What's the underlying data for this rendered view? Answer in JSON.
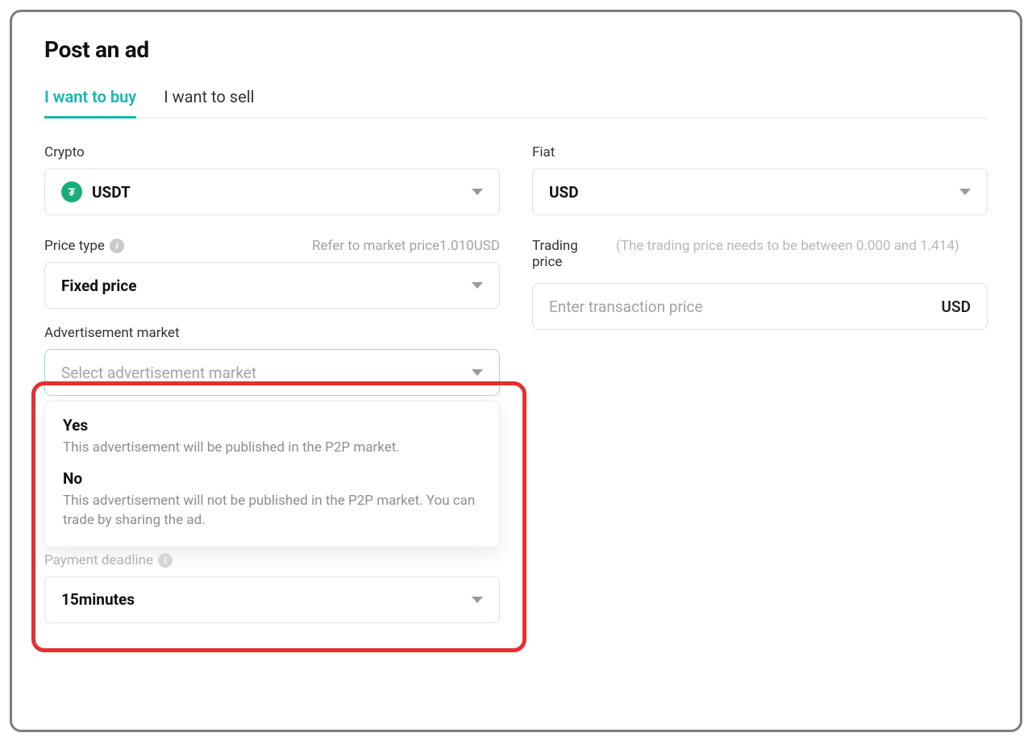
{
  "title": "Post an ad",
  "tabs": {
    "buy": "I want to buy",
    "sell": "I want to sell"
  },
  "crypto": {
    "label": "Crypto",
    "value": "USDT",
    "icon_letter": "₮"
  },
  "fiat": {
    "label": "Fiat",
    "value": "USD"
  },
  "price_type": {
    "label": "Price type",
    "hint": "Refer to market price1.010USD",
    "value": "Fixed price"
  },
  "trading_price": {
    "label": "Trading price",
    "hint": "(The trading price needs to be between 0.000 and 1.414)",
    "placeholder": "Enter transaction price",
    "unit": "USD"
  },
  "ad_market": {
    "label": "Advertisement market",
    "placeholder": "Select advertisement market",
    "options": [
      {
        "title": "Yes",
        "desc": "This advertisement will be published in the P2P market."
      },
      {
        "title": "No",
        "desc": "This advertisement will not be published in the P2P market. You can trade by sharing the ad."
      }
    ]
  },
  "payment_deadline": {
    "label": "Payment deadline",
    "value": "15minutes"
  },
  "info_glyph": "i"
}
